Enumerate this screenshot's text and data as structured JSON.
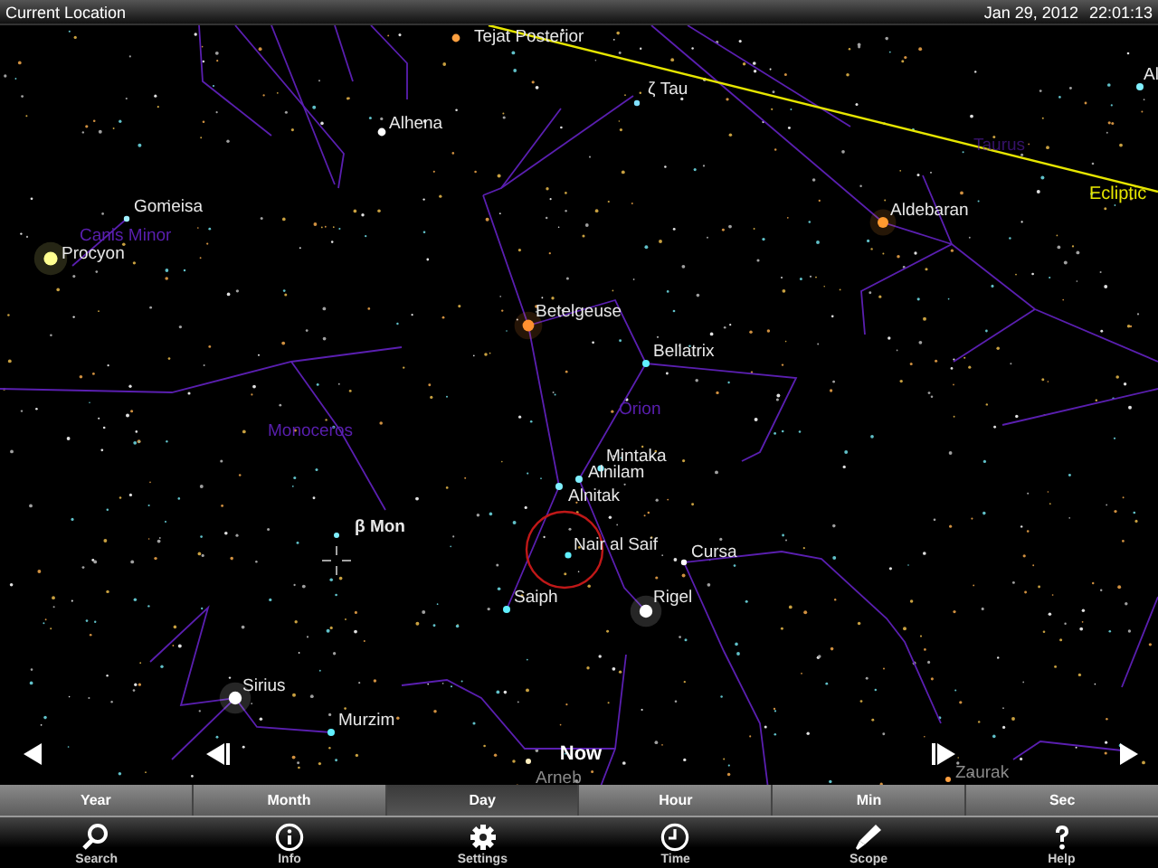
{
  "status_bar": {
    "location": "Current Location",
    "date": "Jan 29, 2012",
    "time": "22:01:13"
  },
  "sky_map": {
    "stars": [
      {
        "name": "Tejat Posterior",
        "color": "#ffa040",
        "faded": false
      },
      {
        "name": "ζ Tau",
        "color": "#80e0ff",
        "faded": false
      },
      {
        "name": "Alhena",
        "color": "#ffffff",
        "faded": false
      },
      {
        "name": "Gomeisa",
        "color": "#a0f0ff",
        "faded": false
      },
      {
        "name": "Procyon",
        "color": "#ffff90",
        "faded": false
      },
      {
        "name": "Aldebaran",
        "color": "#ff9a30",
        "faded": false
      },
      {
        "name": "Betelgeuse",
        "color": "#ff9030",
        "faded": false
      },
      {
        "name": "Bellatrix",
        "color": "#60f0ff",
        "faded": false
      },
      {
        "name": "Mintaka",
        "color": "#80f0ff",
        "faded": false
      },
      {
        "name": "Alnilam",
        "color": "#80f0ff",
        "faded": false
      },
      {
        "name": "Alnitak",
        "color": "#80f0ff",
        "faded": false
      },
      {
        "name": "β Mon",
        "color": "#80f0ff",
        "faded": false
      },
      {
        "name": "Nair al Saif",
        "color": "#60f0ff",
        "faded": false
      },
      {
        "name": "Cursa",
        "color": "#ffffff",
        "faded": false
      },
      {
        "name": "Saiph",
        "color": "#60f0ff",
        "faded": false
      },
      {
        "name": "Rigel",
        "color": "#ffffff",
        "faded": false
      },
      {
        "name": "Sirius",
        "color": "#ffffff",
        "faded": false
      },
      {
        "name": "Murzim",
        "color": "#60f0ff",
        "faded": false
      },
      {
        "name": "Arneb",
        "color": "#fff0c0",
        "faded": true
      },
      {
        "name": "Zaurak",
        "color": "#ffa040",
        "faded": true
      },
      {
        "name": "Al",
        "color": "#80f0ff",
        "faded": false
      }
    ],
    "constellations": [
      {
        "name": "Canis Minor"
      },
      {
        "name": "Monoceros"
      },
      {
        "name": "Orion"
      },
      {
        "name": "Taurus"
      }
    ],
    "ecliptic": {
      "label": "Ecliptic"
    },
    "target_circle": {
      "shown": true
    }
  },
  "time_controls": {
    "now": "Now"
  },
  "step_units": [
    {
      "label": "Year",
      "selected": false
    },
    {
      "label": "Month",
      "selected": false
    },
    {
      "label": "Day",
      "selected": true
    },
    {
      "label": "Hour",
      "selected": false
    },
    {
      "label": "Min",
      "selected": false
    },
    {
      "label": "Sec",
      "selected": false
    }
  ],
  "toolbar": [
    {
      "label": "Search",
      "kind": "search"
    },
    {
      "label": "Info",
      "kind": "info"
    },
    {
      "label": "Settings",
      "kind": "settings"
    },
    {
      "label": "Time",
      "kind": "time"
    },
    {
      "label": "Scope",
      "kind": "scope"
    },
    {
      "label": "Help",
      "kind": "help"
    }
  ]
}
